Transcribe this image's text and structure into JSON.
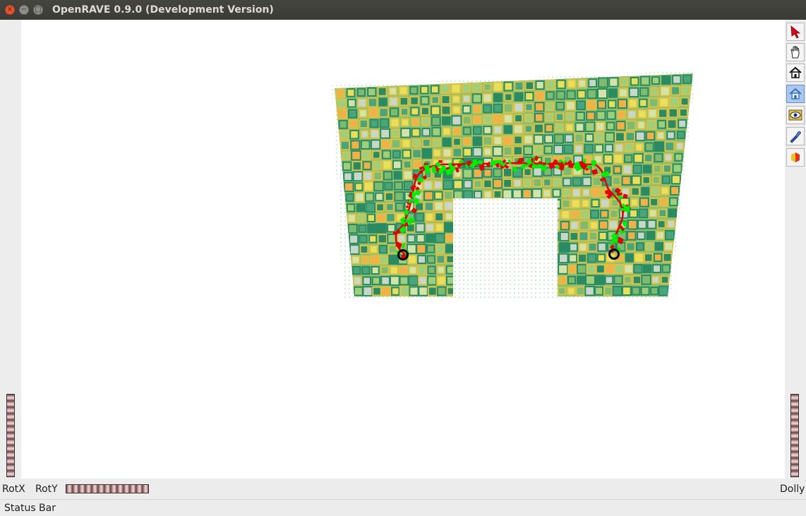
{
  "window": {
    "title": "OpenRAVE 0.9.0 (Development Version)",
    "buttons": [
      "close",
      "minimize",
      "maximize"
    ]
  },
  "toolbar": {
    "tools": [
      {
        "name": "select-pointer",
        "icon": "arrow-pointer-icon",
        "active": false
      },
      {
        "name": "pan-hand",
        "icon": "hand-icon",
        "active": false
      },
      {
        "name": "home-view",
        "icon": "house-icon",
        "active": false
      },
      {
        "name": "set-home",
        "icon": "house-outline-icon",
        "active": true
      },
      {
        "name": "view-all",
        "icon": "eye-icon",
        "active": false
      },
      {
        "name": "headlight",
        "icon": "flashlight-icon",
        "active": false
      },
      {
        "name": "perspective-toggle",
        "icon": "cube-icon",
        "active": false
      }
    ]
  },
  "controls": {
    "rotx_label": "RotX",
    "roty_label": "RotY",
    "dolly_label": "Dolly"
  },
  "status": {
    "text": "Status Bar"
  },
  "colors": {
    "path": "#e00000",
    "samples_green": "#00ee00",
    "tile_teal": "#2a8a62",
    "tile_yellow": "#e8df5a",
    "tile_orange": "#f0b248",
    "titlebar": "#3c3b37"
  }
}
